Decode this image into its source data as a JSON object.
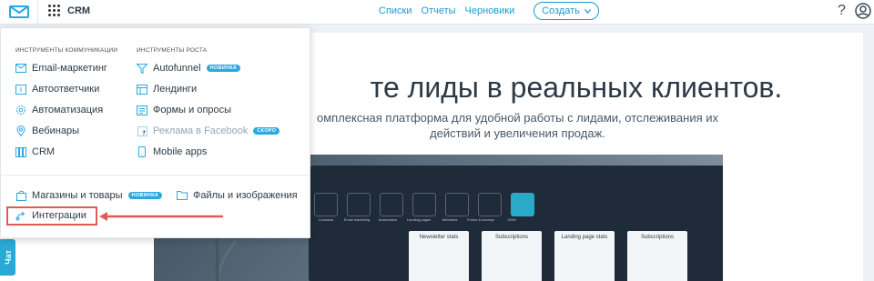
{
  "topbar": {
    "app_label": "CRM",
    "nav": [
      "Списки",
      "Отчеты",
      "Черновики"
    ],
    "create_label": "Создать",
    "help_glyph": "?"
  },
  "hero": {
    "title": "те лиды в реальных клиентов.",
    "subtitle": "омплексная платформа для удобной работы с лидами, отслеживания их действий и увеличения продаж."
  },
  "screenshot": {
    "labels": [
      "Contacts",
      "Email marketing",
      "Automation",
      "Landing pages",
      "Webinars",
      "Forms & surveys",
      "CRM"
    ],
    "cards": [
      "Newsletter stats",
      "Subscriptions",
      "Landing page stats",
      "Subscriptions"
    ]
  },
  "chat_label": "Чат",
  "menu": {
    "col1_title": "ИНСТРУМЕНТЫ КОММУНИКАЦИИ",
    "col2_title": "ИНСТРУМЕНТЫ РОСТА",
    "col1": [
      {
        "label": "Email-маркетинг",
        "icon": "envelope-icon"
      },
      {
        "label": "Автоответчики",
        "icon": "autoresponder-icon"
      },
      {
        "label": "Автоматизация",
        "icon": "gear-icon"
      },
      {
        "label": "Вебинары",
        "icon": "pin-icon"
      },
      {
        "label": "CRM",
        "icon": "columns-icon"
      }
    ],
    "col2": [
      {
        "label": "Autofunnel",
        "icon": "funnel-icon",
        "badge": "НОВИНКА"
      },
      {
        "label": "Лендинги",
        "icon": "layout-icon"
      },
      {
        "label": "Формы и опросы",
        "icon": "form-icon"
      },
      {
        "label": "Реклама в Facebook",
        "icon": "facebook-icon",
        "badge": "СКОРО"
      },
      {
        "label": "Mobile apps",
        "icon": "phone-icon"
      }
    ],
    "bottom": [
      {
        "label": "Магазины и товары",
        "icon": "bag-icon",
        "badge": "НОВИНКА"
      },
      {
        "label": "Файлы и изображения",
        "icon": "folder-icon"
      },
      {
        "label": "Интеграции",
        "icon": "integrations-icon"
      }
    ]
  },
  "colors": {
    "accent": "#1b9ad6",
    "badge": "#2aa9e0",
    "highlight": "#e05a57"
  }
}
